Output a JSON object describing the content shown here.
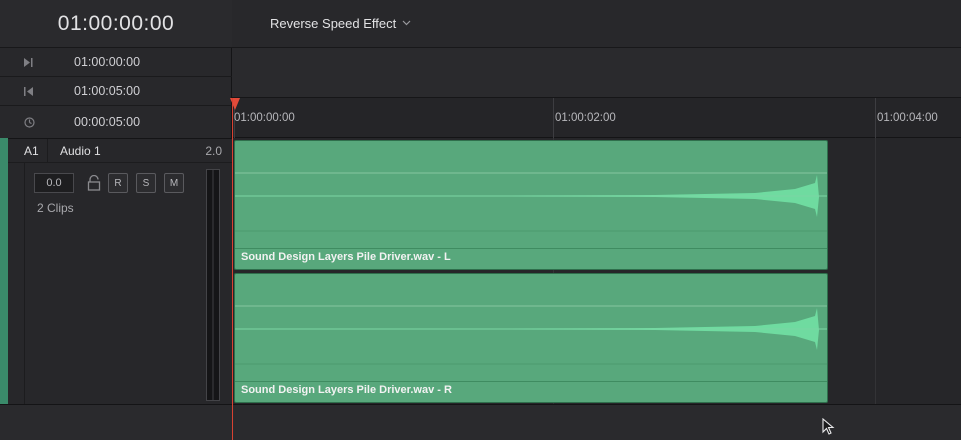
{
  "header": {
    "current_timecode": "01:00:00:00",
    "timeline_name": "Reverse Speed Effect"
  },
  "range": {
    "in_point": "01:00:00:00",
    "out_point": "01:00:05:00",
    "duration": "00:00:05:00"
  },
  "ruler": {
    "labels": [
      "01:00:00:00",
      "01:00:02:00",
      "01:00:04:00"
    ]
  },
  "track": {
    "id": "A1",
    "name": "Audio 1",
    "channels": "2.0",
    "volume": "0.0",
    "buttons": {
      "record": "R",
      "solo": "S",
      "mute": "M"
    },
    "clip_count": "2 Clips"
  },
  "clips": [
    {
      "label": "Sound Design Layers Pile Driver.wav - L"
    },
    {
      "label": "Sound Design Layers Pile Driver.wav - R"
    }
  ],
  "icons": {
    "in_point": "mark-in-icon",
    "out_point": "mark-out-icon",
    "duration": "clock-icon",
    "lock": "lock-icon",
    "dropdown": "chevron-down-icon",
    "cursor": "mouse-pointer-icon"
  },
  "colors": {
    "clip": "#58a87c",
    "playhead": "#d84232",
    "track_accent": "#3a8a6a"
  }
}
